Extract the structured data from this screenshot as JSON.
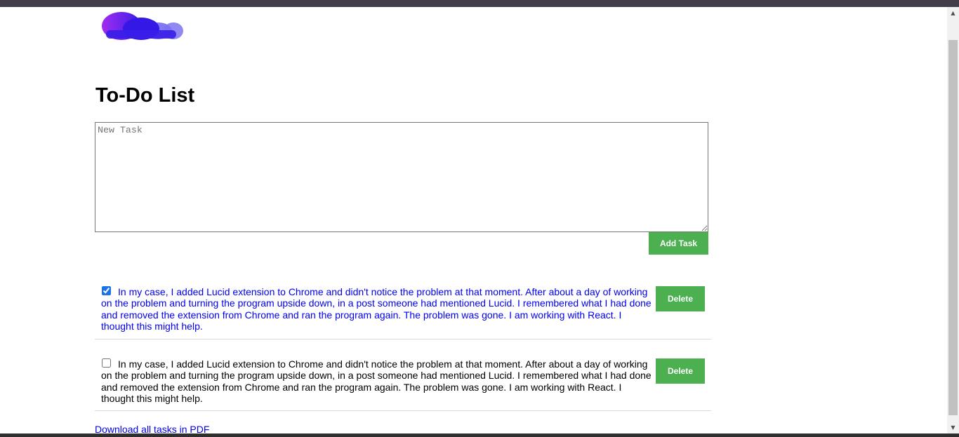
{
  "header": {
    "logo": "cloud-logo"
  },
  "page": {
    "title": "To-Do List"
  },
  "new_task": {
    "placeholder": "New Task",
    "value": "",
    "add_button_label": "Add Task"
  },
  "tasks": [
    {
      "checked": true,
      "text": "In my case, I added Lucid extension to Chrome and didn't notice the problem at that moment. After about a day of working on the problem and turning the program upside down, in a post someone had mentioned Lucid. I remembered what I had done and removed the extension from Chrome and ran the program again. The problem was gone. I am working with React. I thought this might help.",
      "delete_label": "Delete"
    },
    {
      "checked": false,
      "text": "In my case, I added Lucid extension to Chrome and didn't notice the problem at that moment. After about a day of working on the problem and turning the program upside down, in a post someone had mentioned Lucid. I remembered what I had done and removed the extension from Chrome and ran the program again. The problem was gone. I am working with React. I thought this might help.",
      "delete_label": "Delete"
    }
  ],
  "footer": {
    "download_link": "Download all tasks in PDF"
  },
  "colors": {
    "button_green": "#4caf50",
    "completed_task_text": "#0000ee",
    "link": "#0000ee"
  }
}
